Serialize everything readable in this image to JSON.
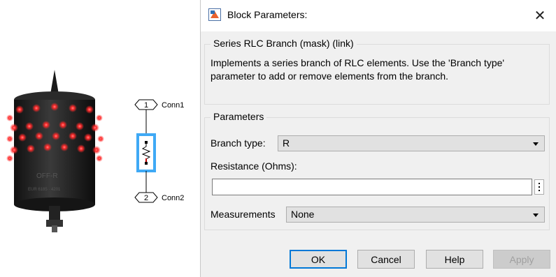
{
  "dialog": {
    "title": "Block Parameters:",
    "close_glyph": "✕",
    "mask_group_title": "Series RLC Branch (mask) (link)",
    "description": "Implements a series branch of RLC elements. Use the 'Branch type' parameter to add or remove elements from the branch.",
    "parameters_group_title": "Parameters",
    "branch_type": {
      "label": "Branch type:",
      "value": "R"
    },
    "resistance": {
      "label": "Resistance (Ohms):",
      "value": "",
      "placeholder": ""
    },
    "measurements": {
      "label": "Measurements",
      "value": "None"
    },
    "buttons": {
      "ok": "OK",
      "cancel": "Cancel",
      "help": "Help",
      "apply": "Apply"
    }
  },
  "block": {
    "port1_number": "1",
    "port1_name": "Conn1",
    "port2_number": "2",
    "port2_name": "Conn2"
  },
  "colors": {
    "accent": "#0078d7",
    "block_highlight": "#3fa9f5",
    "resistor_red": "#c00000",
    "led_red": "#ff2a2a"
  },
  "icons": {
    "app": "simulink-block-icon",
    "close": "close-icon",
    "dropdown": "chevron-down-icon",
    "more": "kebab-menu-icon"
  }
}
